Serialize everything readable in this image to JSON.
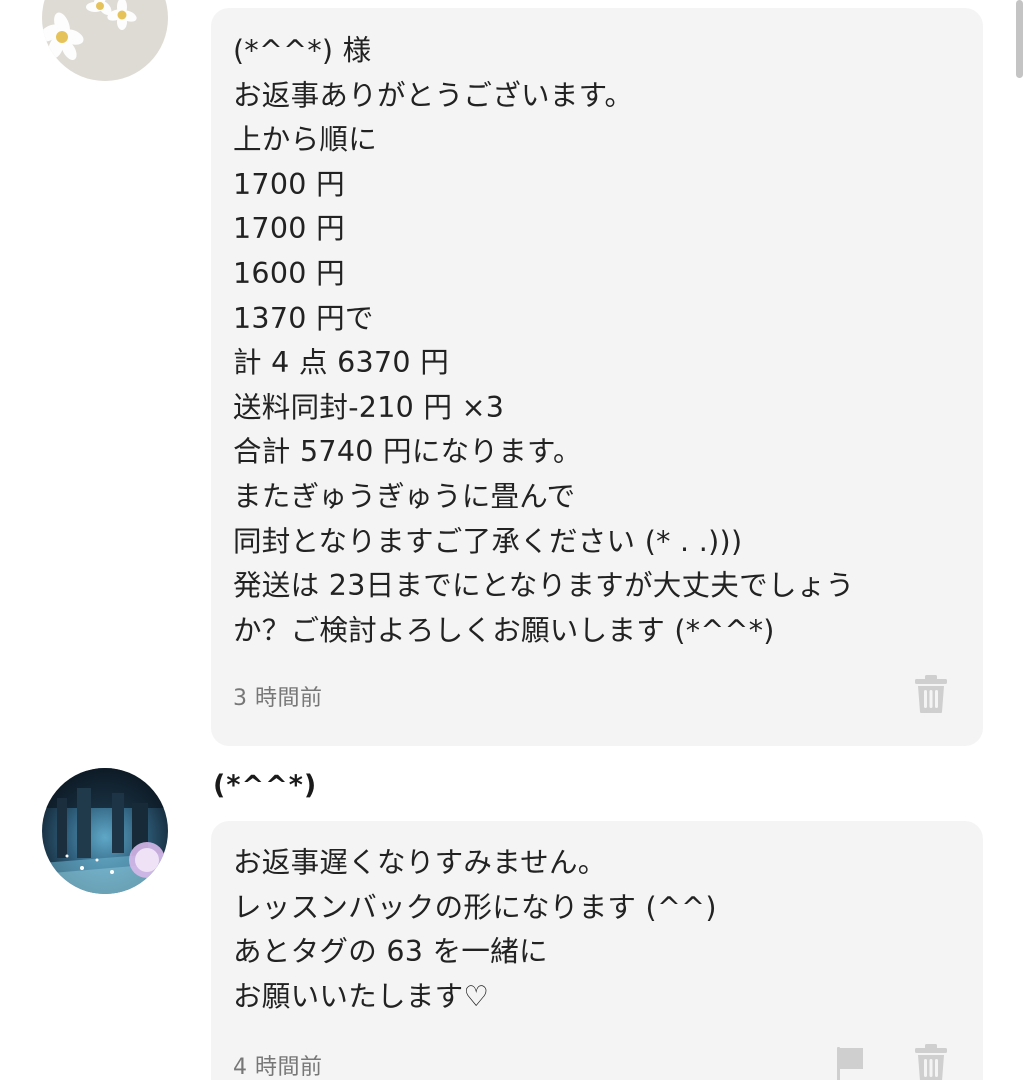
{
  "messages": [
    {
      "lines": [
        "(*^^*) 様",
        "お返事ありがとうございます。",
        "上から順に",
        "1700 円",
        "1700 円",
        "1600 円",
        "1370 円で",
        "計 4 点 6370 円",
        "送料同封-210 円 ×3",
        "合計 5740 円になります。",
        "またぎゅうぎゅうに畳んで",
        "同封となりますご了承ください (* . .)))",
        "発送は 23日までにとなりますが大丈夫でしょう",
        "か？ご検討よろしくお願いします (*^^*)"
      ],
      "time": "3 時間前",
      "actions": {
        "delete_icon": "trash-icon"
      }
    },
    {
      "sender": "(*^^*)",
      "lines": [
        "お返事遅くなりすみません。",
        "レッスンバックの形になります (^^)",
        "あとタグの 63 を一緒に",
        "お願いいたします♡"
      ],
      "time": "4 時間前",
      "actions": {
        "report_icon": "flag-icon",
        "delete_icon": "trash-icon"
      }
    }
  ],
  "colors": {
    "bubble_background": "#f4f4f4",
    "timestamp": "#777777",
    "icon_gray": "#cfcfcf"
  }
}
